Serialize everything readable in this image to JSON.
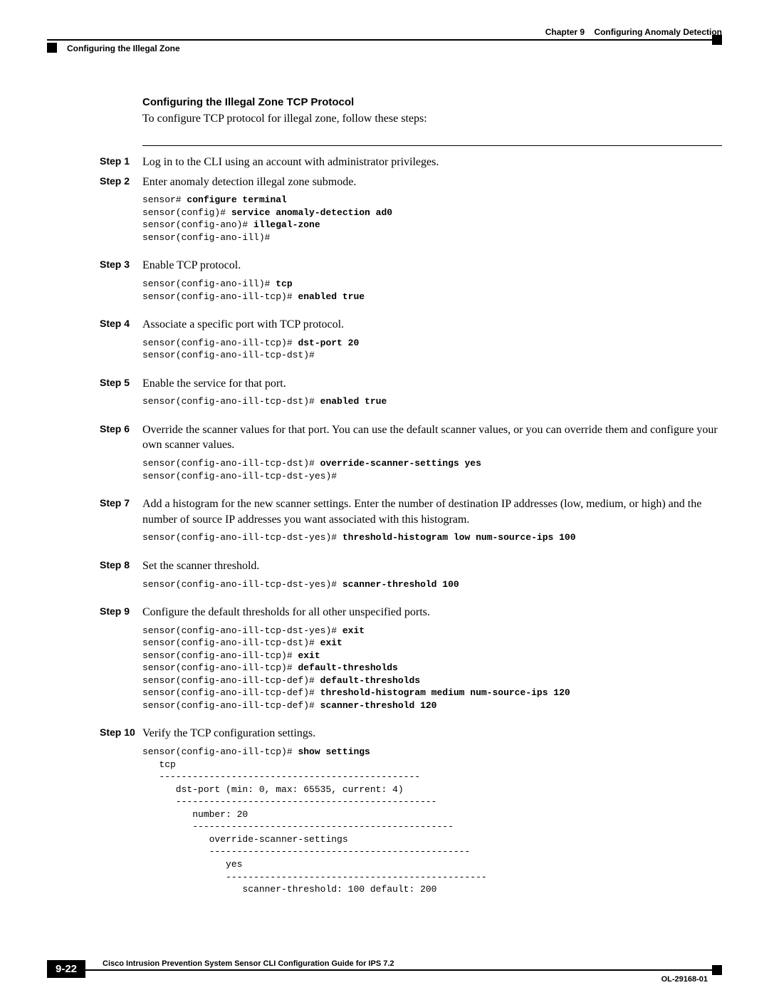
{
  "header": {
    "chapter": "Chapter 9",
    "chapter_title": "Configuring Anomaly Detection",
    "section": "Configuring the Illegal Zone"
  },
  "content": {
    "heading": "Configuring the Illegal Zone TCP Protocol",
    "intro": "To configure TCP protocol for illegal zone, follow these steps:"
  },
  "steps": [
    {
      "label": "Step 1",
      "text": "Log in to the CLI using an account with administrator privileges."
    },
    {
      "label": "Step 2",
      "text": "Enter anomaly detection illegal zone submode.",
      "code": [
        {
          "plain": "sensor# ",
          "bold": "configure terminal"
        },
        {
          "plain": "sensor(config)# ",
          "bold": "service anomaly-detection ad0"
        },
        {
          "plain": "sensor(config-ano)# ",
          "bold": "illegal-zone"
        },
        {
          "plain": "sensor(config-ano-ill)#",
          "bold": ""
        }
      ]
    },
    {
      "label": "Step 3",
      "text": "Enable TCP protocol.",
      "code": [
        {
          "plain": "sensor(config-ano-ill)# ",
          "bold": "tcp"
        },
        {
          "plain": "sensor(config-ano-ill-tcp)# ",
          "bold": "enabled true"
        }
      ]
    },
    {
      "label": "Step 4",
      "text": "Associate a specific port with TCP protocol.",
      "code": [
        {
          "plain": "sensor(config-ano-ill-tcp)# ",
          "bold": "dst-port 20"
        },
        {
          "plain": "sensor(config-ano-ill-tcp-dst)#",
          "bold": ""
        }
      ]
    },
    {
      "label": "Step 5",
      "text": "Enable the service for that port.",
      "code": [
        {
          "plain": "sensor(config-ano-ill-tcp-dst)# ",
          "bold": "enabled true"
        }
      ]
    },
    {
      "label": "Step 6",
      "text": "Override the scanner values for that port. You can use the default scanner values, or you can override them and configure your own scanner values.",
      "code": [
        {
          "plain": "sensor(config-ano-ill-tcp-dst)# ",
          "bold": "override-scanner-settings yes"
        },
        {
          "plain": "sensor(config-ano-ill-tcp-dst-yes)#",
          "bold": ""
        }
      ]
    },
    {
      "label": "Step 7",
      "text": "Add a histogram for the new scanner settings. Enter the number of destination IP addresses (low, medium, or high) and the number of source IP addresses you want associated with this histogram.",
      "code": [
        {
          "plain": "sensor(config-ano-ill-tcp-dst-yes)# ",
          "bold": "threshold-histogram low num-source-ips 100"
        }
      ]
    },
    {
      "label": "Step 8",
      "text": "Set the scanner threshold.",
      "code": [
        {
          "plain": "sensor(config-ano-ill-tcp-dst-yes)# ",
          "bold": "scanner-threshold 100"
        }
      ]
    },
    {
      "label": "Step 9",
      "text": "Configure the default thresholds for all other unspecified ports.",
      "code": [
        {
          "plain": "sensor(config-ano-ill-tcp-dst-yes)# ",
          "bold": "exit"
        },
        {
          "plain": "sensor(config-ano-ill-tcp-dst)# ",
          "bold": "exit"
        },
        {
          "plain": "sensor(config-ano-ill-tcp)# ",
          "bold": "exit"
        },
        {
          "plain": "sensor(config-ano-ill-tcp)# ",
          "bold": "default-thresholds"
        },
        {
          "plain": "sensor(config-ano-ill-tcp-def)# ",
          "bold": "default-thresholds"
        },
        {
          "plain": "sensor(config-ano-ill-tcp-def)# ",
          "bold": "threshold-histogram medium num-source-ips 120"
        },
        {
          "plain": "sensor(config-ano-ill-tcp-def)# ",
          "bold": "scanner-threshold 120"
        }
      ]
    },
    {
      "label": "Step 10",
      "text": "Verify the TCP configuration settings.",
      "code": [
        {
          "plain": "sensor(config-ano-ill-tcp)# ",
          "bold": "show settings"
        },
        {
          "plain": "   tcp",
          "bold": ""
        },
        {
          "plain": "   -----------------------------------------------",
          "bold": ""
        },
        {
          "plain": "      dst-port (min: 0, max: 65535, current: 4)",
          "bold": ""
        },
        {
          "plain": "      -----------------------------------------------",
          "bold": ""
        },
        {
          "plain": "         number: 20",
          "bold": ""
        },
        {
          "plain": "         -----------------------------------------------",
          "bold": ""
        },
        {
          "plain": "            override-scanner-settings",
          "bold": ""
        },
        {
          "plain": "            -----------------------------------------------",
          "bold": ""
        },
        {
          "plain": "               yes",
          "bold": ""
        },
        {
          "plain": "               -----------------------------------------------",
          "bold": ""
        },
        {
          "plain": "                  scanner-threshold: 100 default: 200",
          "bold": ""
        }
      ]
    }
  ],
  "footer": {
    "title": "Cisco Intrusion Prevention System Sensor CLI Configuration Guide for IPS 7.2",
    "page": "9-22",
    "doc_id": "OL-29168-01"
  }
}
